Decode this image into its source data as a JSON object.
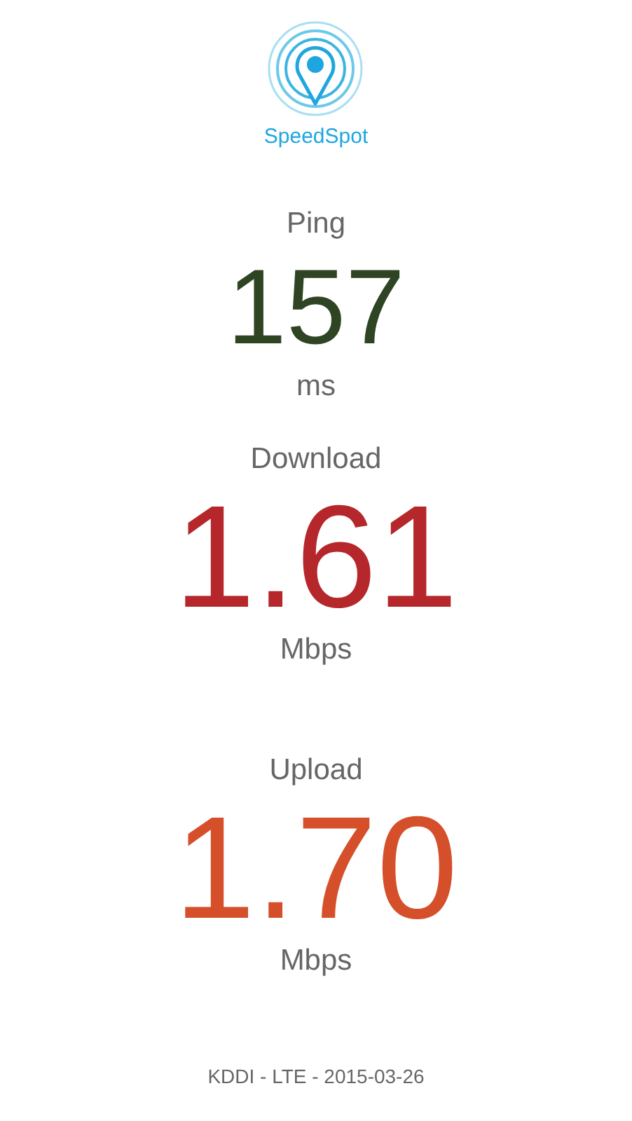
{
  "app": {
    "name": "SpeedSpot"
  },
  "metrics": [
    {
      "label": "Ping",
      "value": "157",
      "unit": "ms",
      "color": "#2e4423",
      "kind": "medium"
    },
    {
      "label": "Download",
      "value": "1.61",
      "unit": "Mbps",
      "color": "#b5272b",
      "kind": "large"
    },
    {
      "label": "Upload",
      "value": "1.70",
      "unit": "Mbps",
      "color": "#d5502a",
      "kind": "large"
    }
  ],
  "footer": "KDDI - LTE - 2015-03-26"
}
